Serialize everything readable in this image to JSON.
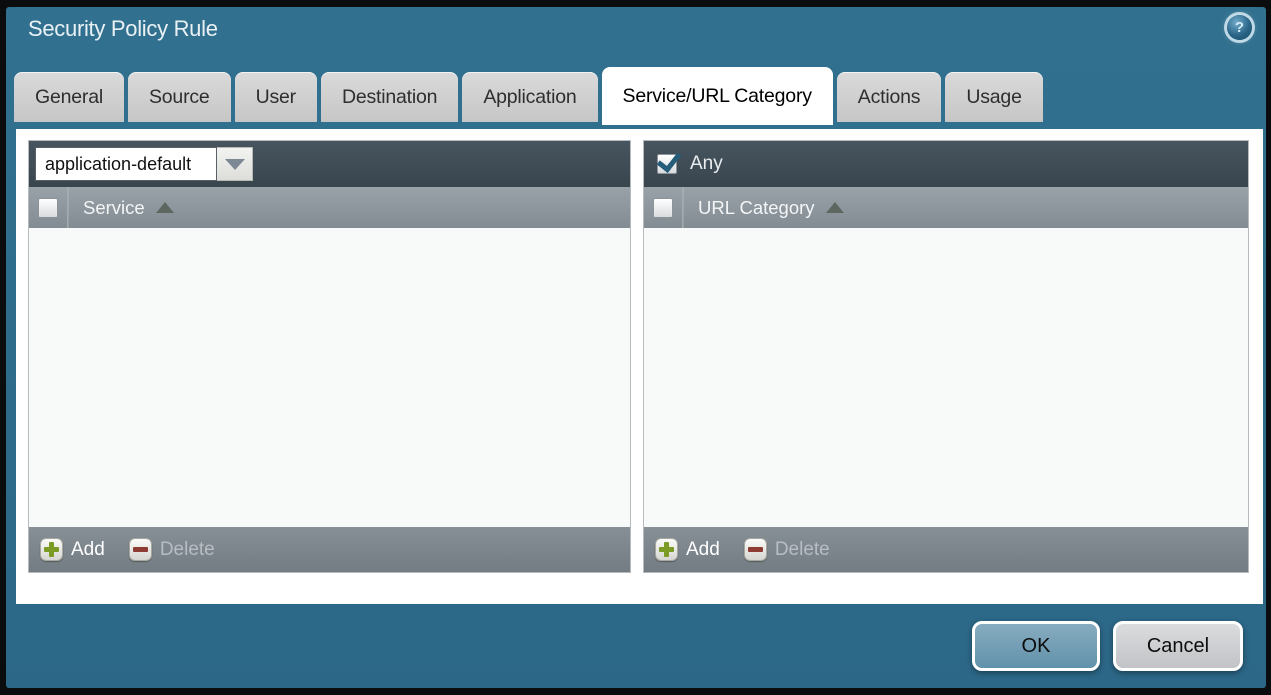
{
  "window": {
    "title": "Security Policy Rule"
  },
  "tabs": [
    {
      "label": "General",
      "active": false
    },
    {
      "label": "Source",
      "active": false
    },
    {
      "label": "User",
      "active": false
    },
    {
      "label": "Destination",
      "active": false
    },
    {
      "label": "Application",
      "active": false
    },
    {
      "label": "Service/URL Category",
      "active": true
    },
    {
      "label": "Actions",
      "active": false
    },
    {
      "label": "Usage",
      "active": false
    }
  ],
  "service_panel": {
    "dropdown": {
      "value": "application-default"
    },
    "header": {
      "label": "Service",
      "sort": "asc",
      "checked": false
    },
    "rows": [],
    "footer": {
      "add_label": "Add",
      "delete_label": "Delete",
      "delete_enabled": false
    }
  },
  "url_category_panel": {
    "any": {
      "label": "Any",
      "checked": true
    },
    "header": {
      "label": "URL Category",
      "sort": "asc",
      "checked": false
    },
    "rows": [],
    "footer": {
      "add_label": "Add",
      "delete_label": "Delete",
      "delete_enabled": false
    }
  },
  "dialog_buttons": {
    "ok_label": "OK",
    "cancel_label": "Cancel"
  },
  "icons": {
    "help": "help-icon",
    "dropdown": "chevron-down-icon",
    "sort": "sort-asc-icon",
    "check": "checkmark-icon",
    "add": "plus-icon",
    "delete": "minus-icon"
  },
  "colors": {
    "window_teal": "#2e6d8d",
    "toolbar_dark": "#3f4c55",
    "header_grey": "#8b949a",
    "footer_grey": "#7c858c",
    "ok_button_blue": "#6f9db5",
    "cancel_button_grey": "#ccced1",
    "add_plus_green": "#7c9b24",
    "delete_minus_red": "#8d3b33",
    "checkmark_blue": "#265d7a",
    "active_tab_white": "#ffffff",
    "inactive_tab_grey": "#cdcdcd"
  }
}
